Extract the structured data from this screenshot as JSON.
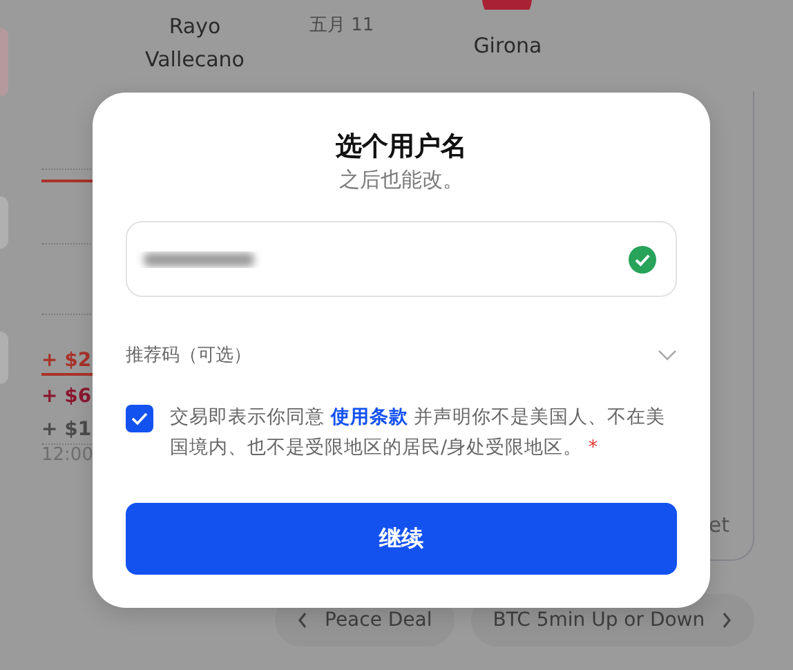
{
  "background": {
    "match": {
      "home_team": "Rayo Vallecano",
      "date": "五月 11",
      "away_team": "Girona"
    },
    "price_labels": [
      {
        "text": "+ $2",
        "color": "#a8322a"
      },
      {
        "text": "+ $6",
        "color": "#8a1730"
      },
      {
        "text": "+ $1",
        "color": "#4a4a4a"
      }
    ],
    "time_label": "12:00",
    "card_fragment": "et",
    "nav": [
      {
        "label": "Peace Deal",
        "kind": "back"
      },
      {
        "label": "BTC 5min Up or Down",
        "kind": "forward"
      }
    ]
  },
  "dialog": {
    "title": "选个用户名",
    "subtitle": "之后也能改。",
    "username_field": {
      "verified": true
    },
    "referral": {
      "label": "推荐码（可选）",
      "expanded": false
    },
    "consent": {
      "checked": true,
      "text_before": "交易即表示你同意 ",
      "link": "使用条款",
      "text_after": " 并声明你不是美国人、不在美国境内、也不是受限地区的居民/身处受限地区。",
      "required_mark": "*"
    },
    "continue_button": "继续"
  }
}
